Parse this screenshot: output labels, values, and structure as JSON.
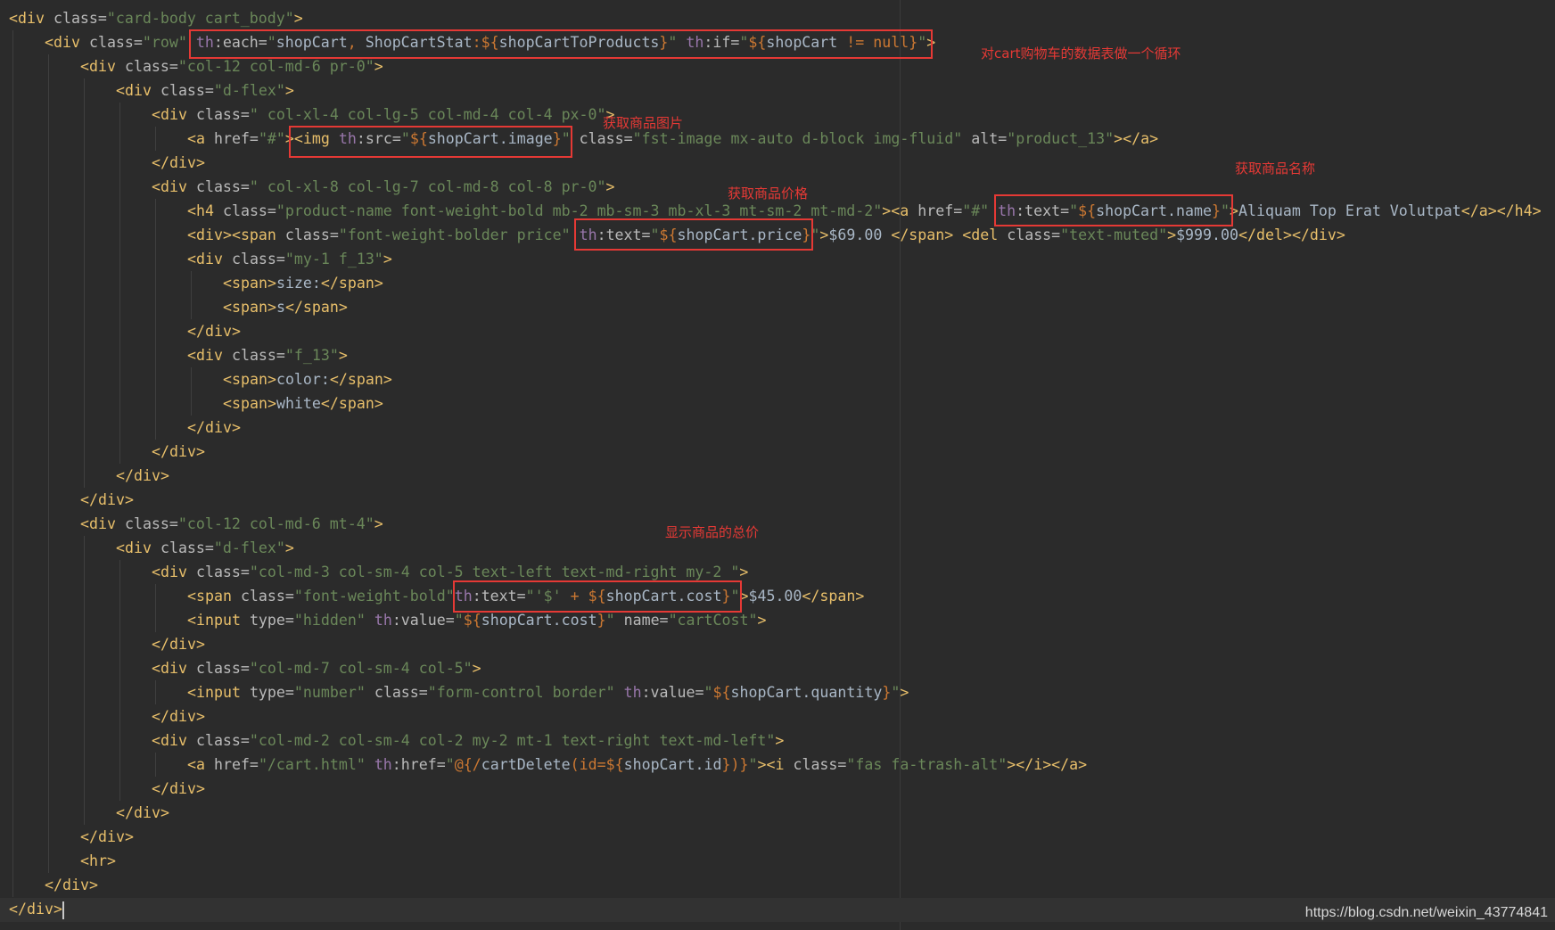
{
  "editor": {
    "lines": [
      {
        "indent": 0,
        "tokens": [
          [
            "t",
            "<div"
          ],
          [
            "a",
            " class="
          ],
          [
            "s",
            "\"card-body cart_body\""
          ],
          [
            "t",
            ">"
          ]
        ]
      },
      {
        "indent": 1,
        "tokens": [
          [
            "t",
            "<div"
          ],
          [
            "a",
            " class="
          ],
          [
            "s",
            "\"row\" "
          ],
          [
            "n",
            "th"
          ],
          [
            "a",
            ":each="
          ],
          [
            "s",
            "\""
          ],
          [
            "v",
            "shopCart"
          ],
          [
            "x",
            ", "
          ],
          [
            "v",
            "ShopCartStat"
          ],
          [
            "x",
            ":${"
          ],
          [
            "v",
            "shopCartToProducts"
          ],
          [
            "x",
            "}"
          ],
          [
            "s",
            "\" "
          ],
          [
            "n",
            "th"
          ],
          [
            "a",
            ":if="
          ],
          [
            "s",
            "\""
          ],
          [
            "x",
            "${"
          ],
          [
            "v",
            "shopCart"
          ],
          [
            "x",
            " != null}"
          ],
          [
            "s",
            "\""
          ],
          [
            "t",
            ">"
          ]
        ]
      },
      {
        "indent": 2,
        "tokens": [
          [
            "t",
            "<div"
          ],
          [
            "a",
            " class="
          ],
          [
            "s",
            "\"col-12 col-md-6 pr-0\""
          ],
          [
            "t",
            ">"
          ]
        ]
      },
      {
        "indent": 3,
        "tokens": [
          [
            "t",
            "<div"
          ],
          [
            "a",
            " class="
          ],
          [
            "s",
            "\"d-flex\""
          ],
          [
            "t",
            ">"
          ]
        ]
      },
      {
        "indent": 4,
        "tokens": [
          [
            "t",
            "<div"
          ],
          [
            "a",
            " class="
          ],
          [
            "s",
            "\" col-xl-4 col-lg-5 col-md-4 col-4 px-0\""
          ],
          [
            "t",
            ">"
          ]
        ]
      },
      {
        "indent": 5,
        "tokens": [
          [
            "t",
            "<a"
          ],
          [
            "a",
            " href="
          ],
          [
            "s",
            "\"#\""
          ],
          [
            "t",
            ">"
          ],
          [
            "t",
            "<img"
          ],
          [
            "a",
            " "
          ],
          [
            "n",
            "th"
          ],
          [
            "a",
            ":src="
          ],
          [
            "s",
            "\""
          ],
          [
            "x",
            "${"
          ],
          [
            "v",
            "shopCart.image"
          ],
          [
            "x",
            "}"
          ],
          [
            "s",
            "\""
          ],
          [
            "a",
            " class="
          ],
          [
            "s",
            "\"fst-image mx-auto d-block img-fluid\""
          ],
          [
            "a",
            " alt="
          ],
          [
            "s",
            "\"product_13\""
          ],
          [
            "t",
            "></a>"
          ]
        ]
      },
      {
        "indent": 4,
        "tokens": [
          [
            "t",
            "</div>"
          ]
        ]
      },
      {
        "indent": 4,
        "tokens": [
          [
            "t",
            "<div"
          ],
          [
            "a",
            " class="
          ],
          [
            "s",
            "\" col-xl-8 col-lg-7 col-md-8 col-8 pr-0\""
          ],
          [
            "t",
            ">"
          ]
        ]
      },
      {
        "indent": 5,
        "tokens": [
          [
            "t",
            "<h4"
          ],
          [
            "a",
            " class="
          ],
          [
            "s",
            "\"product-name font-weight-bold mb-2 mb-sm-3 mb-xl-3 mt-sm-2 mt-md-2\""
          ],
          [
            "t",
            ">"
          ],
          [
            "t",
            "<a"
          ],
          [
            "a",
            " href="
          ],
          [
            "s",
            "\"#\" "
          ],
          [
            "n",
            "th"
          ],
          [
            "a",
            ":text="
          ],
          [
            "s",
            "\""
          ],
          [
            "x",
            "${"
          ],
          [
            "v",
            "shopCart.name"
          ],
          [
            "x",
            "}"
          ],
          [
            "s",
            "\""
          ],
          [
            "t",
            ">"
          ],
          [
            "p",
            "Aliquam Top Erat Volutpat"
          ],
          [
            "t",
            "</a></h4>"
          ]
        ]
      },
      {
        "indent": 5,
        "tokens": [
          [
            "t",
            "<div><span"
          ],
          [
            "a",
            " class="
          ],
          [
            "s",
            "\"font-weight-bolder price\" "
          ],
          [
            "n",
            "th"
          ],
          [
            "a",
            ":text="
          ],
          [
            "s",
            "\""
          ],
          [
            "x",
            "${"
          ],
          [
            "v",
            "shopCart.price"
          ],
          [
            "x",
            "}"
          ],
          [
            "s",
            "\""
          ],
          [
            "t",
            ">"
          ],
          [
            "p",
            "$69.00 "
          ],
          [
            "t",
            "</span>"
          ],
          [
            "p",
            " "
          ],
          [
            "t",
            "<del"
          ],
          [
            "a",
            " class="
          ],
          [
            "s",
            "\"text-muted\""
          ],
          [
            "t",
            ">"
          ],
          [
            "p",
            "$999.00"
          ],
          [
            "t",
            "</del></div>"
          ]
        ]
      },
      {
        "indent": 5,
        "tokens": [
          [
            "t",
            "<div"
          ],
          [
            "a",
            " class="
          ],
          [
            "s",
            "\"my-1 f_13\""
          ],
          [
            "t",
            ">"
          ]
        ]
      },
      {
        "indent": 6,
        "tokens": [
          [
            "t",
            "<span>"
          ],
          [
            "p",
            "size:"
          ],
          [
            "t",
            "</span>"
          ]
        ]
      },
      {
        "indent": 6,
        "tokens": [
          [
            "t",
            "<span>"
          ],
          [
            "p",
            "s"
          ],
          [
            "t",
            "</span>"
          ]
        ]
      },
      {
        "indent": 5,
        "tokens": [
          [
            "t",
            "</div>"
          ]
        ]
      },
      {
        "indent": 5,
        "tokens": [
          [
            "t",
            "<div"
          ],
          [
            "a",
            " class="
          ],
          [
            "s",
            "\"f_13\""
          ],
          [
            "t",
            ">"
          ]
        ]
      },
      {
        "indent": 6,
        "tokens": [
          [
            "t",
            "<span>"
          ],
          [
            "p",
            "color:"
          ],
          [
            "t",
            "</span>"
          ]
        ]
      },
      {
        "indent": 6,
        "tokens": [
          [
            "t",
            "<span>"
          ],
          [
            "p",
            "white"
          ],
          [
            "t",
            "</span>"
          ]
        ]
      },
      {
        "indent": 5,
        "tokens": [
          [
            "t",
            "</div>"
          ]
        ]
      },
      {
        "indent": 4,
        "tokens": [
          [
            "t",
            "</div>"
          ]
        ]
      },
      {
        "indent": 3,
        "tokens": [
          [
            "t",
            "</div>"
          ]
        ]
      },
      {
        "indent": 2,
        "tokens": [
          [
            "t",
            "</div>"
          ]
        ]
      },
      {
        "indent": 2,
        "tokens": [
          [
            "t",
            "<div"
          ],
          [
            "a",
            " class="
          ],
          [
            "s",
            "\"col-12 col-md-6 mt-4\""
          ],
          [
            "t",
            ">"
          ]
        ]
      },
      {
        "indent": 3,
        "tokens": [
          [
            "t",
            "<div"
          ],
          [
            "a",
            " class="
          ],
          [
            "s",
            "\"d-flex\""
          ],
          [
            "t",
            ">"
          ]
        ]
      },
      {
        "indent": 4,
        "tokens": [
          [
            "t",
            "<div"
          ],
          [
            "a",
            " class="
          ],
          [
            "s",
            "\"col-md-3 col-sm-4 col-5 text-left text-md-right my-2 \""
          ],
          [
            "t",
            ">"
          ]
        ]
      },
      {
        "indent": 5,
        "tokens": [
          [
            "t",
            "<span"
          ],
          [
            "a",
            " class="
          ],
          [
            "s",
            "\"font-weight-bold\""
          ],
          [
            "n",
            "th"
          ],
          [
            "a",
            ":text="
          ],
          [
            "s",
            "\""
          ],
          [
            "s",
            "'$' "
          ],
          [
            "x",
            "+ ${"
          ],
          [
            "v",
            "shopCart.cost"
          ],
          [
            "x",
            "}"
          ],
          [
            "s",
            "\""
          ],
          [
            "t",
            ">"
          ],
          [
            "p",
            "$45.00"
          ],
          [
            "t",
            "</span>"
          ]
        ]
      },
      {
        "indent": 5,
        "tokens": [
          [
            "t",
            "<input"
          ],
          [
            "a",
            " type="
          ],
          [
            "s",
            "\"hidden\" "
          ],
          [
            "n",
            "th"
          ],
          [
            "a",
            ":value="
          ],
          [
            "s",
            "\""
          ],
          [
            "x",
            "${"
          ],
          [
            "v",
            "shopCart.cost"
          ],
          [
            "x",
            "}"
          ],
          [
            "s",
            "\""
          ],
          [
            "a",
            " name="
          ],
          [
            "s",
            "\"cartCost\""
          ],
          [
            "t",
            ">"
          ]
        ]
      },
      {
        "indent": 4,
        "tokens": [
          [
            "t",
            "</div>"
          ]
        ]
      },
      {
        "indent": 4,
        "tokens": [
          [
            "t",
            "<div"
          ],
          [
            "a",
            " class="
          ],
          [
            "s",
            "\"col-md-7 col-sm-4 col-5\""
          ],
          [
            "t",
            ">"
          ]
        ]
      },
      {
        "indent": 5,
        "tokens": [
          [
            "t",
            "<input"
          ],
          [
            "a",
            " type="
          ],
          [
            "s",
            "\"number\""
          ],
          [
            "a",
            " class="
          ],
          [
            "s",
            "\"form-control border\" "
          ],
          [
            "n",
            "th"
          ],
          [
            "a",
            ":value="
          ],
          [
            "s",
            "\""
          ],
          [
            "x",
            "${"
          ],
          [
            "v",
            "shopCart.quantity"
          ],
          [
            "x",
            "}"
          ],
          [
            "s",
            "\""
          ],
          [
            "t",
            ">"
          ]
        ]
      },
      {
        "indent": 4,
        "tokens": [
          [
            "t",
            "</div>"
          ]
        ]
      },
      {
        "indent": 4,
        "tokens": [
          [
            "t",
            "<div"
          ],
          [
            "a",
            " class="
          ],
          [
            "s",
            "\"col-md-2 col-sm-4 col-2 my-2 mt-1 text-right text-md-left\""
          ],
          [
            "t",
            ">"
          ]
        ]
      },
      {
        "indent": 5,
        "tokens": [
          [
            "t",
            "<a"
          ],
          [
            "a",
            " href="
          ],
          [
            "s",
            "\"/cart.html\" "
          ],
          [
            "n",
            "th"
          ],
          [
            "a",
            ":href="
          ],
          [
            "s",
            "\""
          ],
          [
            "x",
            "@{/"
          ],
          [
            "v",
            "cartDelete"
          ],
          [
            "x",
            "(id=${"
          ],
          [
            "v",
            "shopCart.id"
          ],
          [
            "x",
            "})}"
          ],
          [
            "s",
            "\""
          ],
          [
            "t",
            "><i"
          ],
          [
            "a",
            " class="
          ],
          [
            "s",
            "\"fas fa-trash-alt\""
          ],
          [
            "t",
            "></i></a>"
          ]
        ]
      },
      {
        "indent": 4,
        "tokens": [
          [
            "t",
            "</div>"
          ]
        ]
      },
      {
        "indent": 3,
        "tokens": [
          [
            "t",
            "</div>"
          ]
        ]
      },
      {
        "indent": 2,
        "tokens": [
          [
            "t",
            "</div>"
          ]
        ]
      },
      {
        "indent": 2,
        "tokens": [
          [
            "t",
            "<hr>"
          ]
        ]
      },
      {
        "indent": 1,
        "tokens": [
          [
            "t",
            "</div>"
          ]
        ]
      },
      {
        "indent": 0,
        "tokens": [
          [
            "t",
            "</div>"
          ]
        ]
      }
    ]
  },
  "annotations": {
    "loop_note": "对cart购物车的数据表做一个循环",
    "image_note": "获取商品图片",
    "price_note": "获取商品价格",
    "name_note": "获取商品名称",
    "total_note": "显示商品的总价"
  },
  "watermark": "https://blog.csdn.net/weixin_43774841",
  "colors": {
    "background": "#2b2b2b",
    "tag": "#e8bf6a",
    "string": "#6a8759",
    "namespace": "#9876aa",
    "annotation": "#e53935"
  }
}
